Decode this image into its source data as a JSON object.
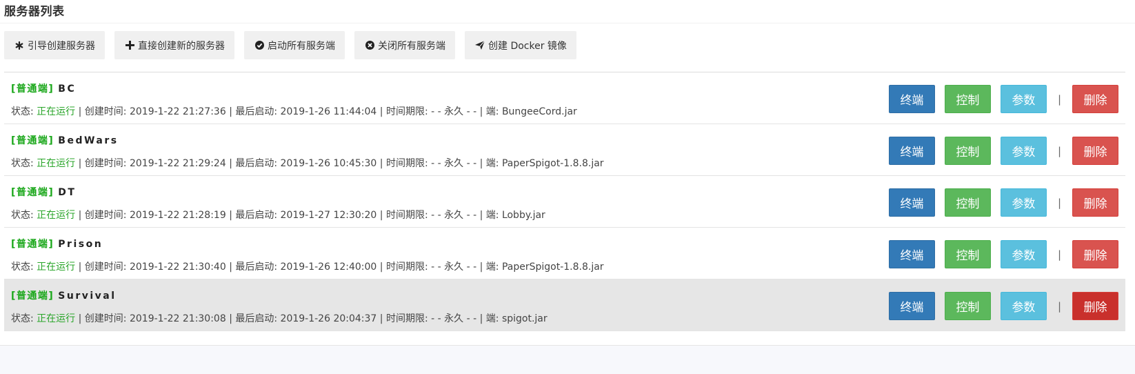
{
  "page": {
    "title": "服务器列表"
  },
  "toolbar": [
    {
      "icon": "asterisk-icon",
      "label": "引导创建服务器"
    },
    {
      "icon": "plus-icon",
      "label": "直接创建新的服务器"
    },
    {
      "icon": "check-circle-icon",
      "label": "启动所有服务端"
    },
    {
      "icon": "close-circle-icon",
      "label": "关闭所有服务端"
    },
    {
      "icon": "paper-plane-icon",
      "label": "创建 Docker 镜像"
    }
  ],
  "labels": {
    "status": "状态:",
    "created": "创建时间:",
    "last_start": "最后启动:",
    "time_limit": "时间期限:",
    "jar": "端:",
    "sep": "|",
    "terminal": "终端",
    "control": "控制",
    "params": "参数",
    "delete": "删除"
  },
  "servers": [
    {
      "tag": "[普通端]",
      "name": "BC",
      "status": "正在运行",
      "created": "2019-1-22 21:27:36",
      "last_start": "2019-1-26 11:44:04",
      "limit": "- - 永久 - -",
      "jar": "BungeeCord.jar"
    },
    {
      "tag": "[普通端]",
      "name": "BedWars",
      "status": "正在运行",
      "created": "2019-1-22 21:29:24",
      "last_start": "2019-1-26 10:45:30",
      "limit": "- - 永久 - -",
      "jar": "PaperSpigot-1.8.8.jar"
    },
    {
      "tag": "[普通端]",
      "name": "DT",
      "status": "正在运行",
      "created": "2019-1-22 21:28:19",
      "last_start": "2019-1-27 12:30:20",
      "limit": "- - 永久 - -",
      "jar": "Lobby.jar"
    },
    {
      "tag": "[普通端]",
      "name": "Prison",
      "status": "正在运行",
      "created": "2019-1-22 21:30:40",
      "last_start": "2019-1-26 12:40:00",
      "limit": "- - 永久 - -",
      "jar": "PaperSpigot-1.8.8.jar"
    },
    {
      "tag": "[普通端]",
      "name": "Survival",
      "status": "正在运行",
      "created": "2019-1-22 21:30:08",
      "last_start": "2019-1-26 20:04:37",
      "limit": "- - 永久 - -",
      "jar": "spigot.jar"
    }
  ],
  "colors": {
    "running": "#2aa52a",
    "tag": "#1aa71a",
    "terminal": "#337ab7",
    "control": "#5cb85c",
    "params": "#5bc0de",
    "delete": "#d9534f"
  }
}
